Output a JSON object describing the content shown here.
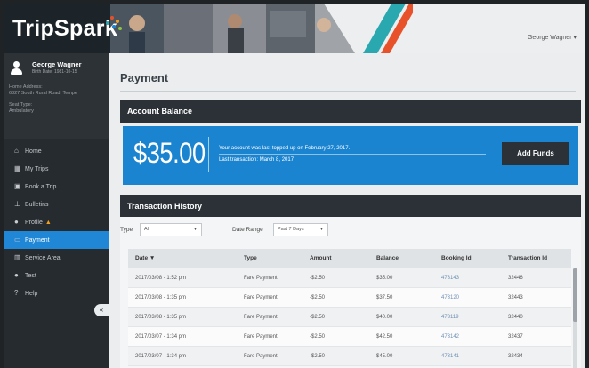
{
  "header": {
    "brand": "TripSpark",
    "user_menu": "George Wagner ▾"
  },
  "sidebar": {
    "profile": {
      "name": "George Wagner",
      "birth_date": "Birth Date: 1981-10-15",
      "address_label": "Home Address:",
      "address": "6327 South Rural Road, Tempe",
      "seat_label": "Seat Type:",
      "seat": "Ambulatory"
    },
    "items": [
      {
        "label": "Home",
        "icon": "home-icon",
        "glyph": "⌂"
      },
      {
        "label": "My Trips",
        "icon": "calendar-icon",
        "glyph": "▦"
      },
      {
        "label": "Book a Trip",
        "icon": "bus-icon",
        "glyph": "▣"
      },
      {
        "label": "Bulletins",
        "icon": "pin-icon",
        "glyph": "⊥"
      },
      {
        "label": "Profile",
        "icon": "user-icon",
        "glyph": "●"
      },
      {
        "label": "Payment",
        "icon": "credit-card-icon",
        "glyph": "▭"
      },
      {
        "label": "Service Area",
        "icon": "map-icon",
        "glyph": "▥"
      },
      {
        "label": "Test",
        "icon": "user-icon",
        "glyph": "●"
      },
      {
        "label": "Help",
        "icon": "question-icon",
        "glyph": "?"
      }
    ],
    "active_index": 5,
    "collapse_glyph": "«"
  },
  "main": {
    "title": "Payment",
    "balance": {
      "heading": "Account Balance",
      "amount": "$35.00",
      "topped_up": "Your account was last topped up on February 27, 2017.",
      "last_transaction": "Last transaction: March 8, 2017",
      "add_funds_label": "Add Funds"
    },
    "history": {
      "heading": "Transaction History",
      "type_label": "Type",
      "type_value": "All",
      "date_range_label": "Date Range",
      "date_range_value": "Past 7 Days",
      "columns": [
        "Date ▼",
        "Type",
        "Amount",
        "Balance",
        "Booking Id",
        "Transaction Id"
      ],
      "rows": [
        [
          "2017/03/08 - 1:52 pm",
          "Fare Payment",
          "-$2.50",
          "$35.00",
          "473143",
          "32446"
        ],
        [
          "2017/03/08 - 1:35 pm",
          "Fare Payment",
          "-$2.50",
          "$37.50",
          "473120",
          "32443"
        ],
        [
          "2017/03/08 - 1:35 pm",
          "Fare Payment",
          "-$2.50",
          "$40.00",
          "473119",
          "32440"
        ],
        [
          "2017/03/07 - 1:34 pm",
          "Fare Payment",
          "-$2.50",
          "$42.50",
          "473142",
          "32437"
        ],
        [
          "2017/03/07 - 1:34 pm",
          "Fare Payment",
          "-$2.50",
          "$45.00",
          "473141",
          "32434"
        ]
      ]
    }
  },
  "colors": {
    "accent": "#1b84d0",
    "sidebar_bg": "#262b30",
    "header_dark": "#2b3137",
    "brand_stripe_teal": "#2aa8b0",
    "brand_stripe_orange": "#e8522a"
  }
}
